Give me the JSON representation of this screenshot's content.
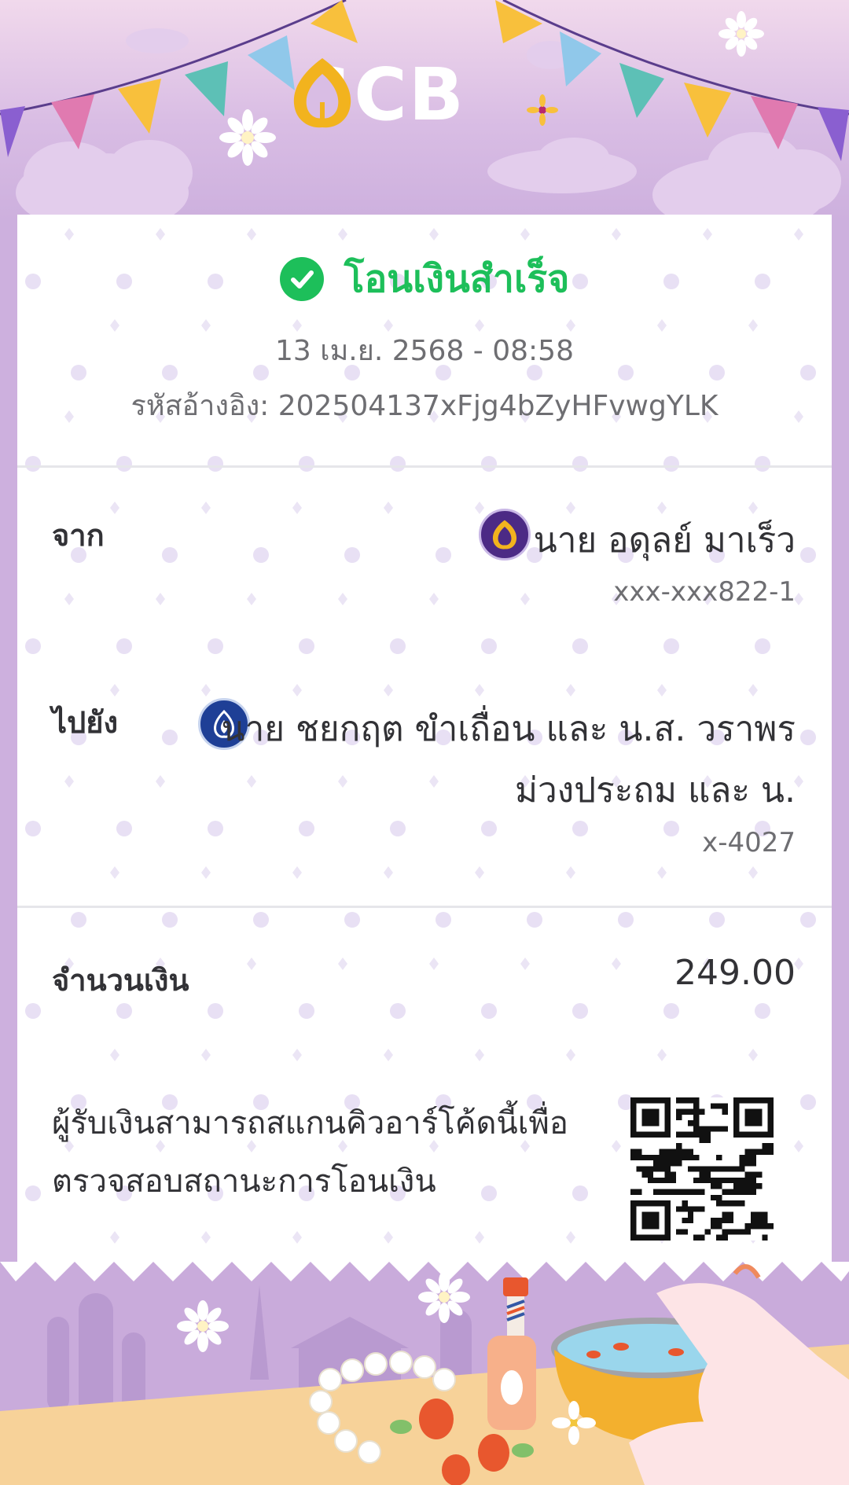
{
  "brand": {
    "name": "SCB",
    "gold": "#f2b31e",
    "purple": "#4c2a85"
  },
  "status": {
    "text": "โอนเงินสำเร็จ",
    "color": "#1dbf5a",
    "icon": "check-circle-icon"
  },
  "datetime": "13 เม.ย. 2568 - 08:58",
  "reference": {
    "label": "รหัสอ้างอิง:",
    "value": "202504137xFjg4bZyHFvwgYLK"
  },
  "from": {
    "label": "จาก",
    "bank_icon": "scb-bank-icon",
    "name": "นาย อดุลย์ มาเร็ว",
    "account": "xxx-xxx822-1"
  },
  "to": {
    "label": "ไปยัง",
    "bank_icon": "bbl-bank-icon",
    "name_line1": "นาย ชยกฤต ขำเถื่อน และ น.ส. วราพร",
    "name_line2": "ม่วงประถม และ น.",
    "account": "x-4027"
  },
  "amount": {
    "label": "จำนวนเงิน",
    "value": "249.00"
  },
  "qr": {
    "line1": "ผู้รับเงินสามารถสแกนคิวอาร์โค้ดนี้เพื่อ",
    "line2": "ตรวจสอบสถานะการโอนเงิน",
    "icon": "qr-code-icon"
  }
}
